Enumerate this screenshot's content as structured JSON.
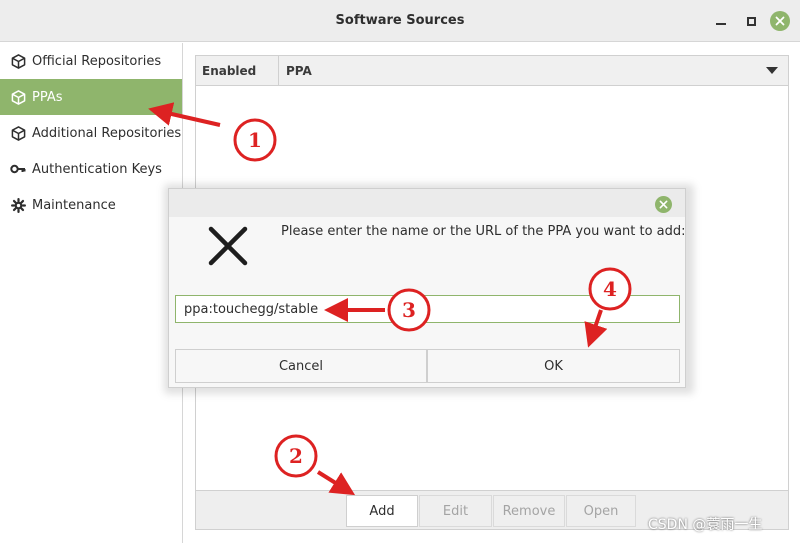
{
  "window": {
    "title": "Software Sources"
  },
  "sidebar": {
    "items": [
      {
        "label": "Official Repositories",
        "icon": "package-icon"
      },
      {
        "label": "PPAs",
        "icon": "package-icon",
        "active": true
      },
      {
        "label": "Additional Repositories",
        "icon": "package-icon"
      },
      {
        "label": "Authentication Keys",
        "icon": "key-icon"
      },
      {
        "label": "Maintenance",
        "icon": "gear-icon"
      }
    ]
  },
  "table": {
    "columns": [
      "Enabled",
      "PPA"
    ]
  },
  "toolbar": {
    "add_label": "Add",
    "edit_label": "Edit",
    "remove_label": "Remove",
    "open_label": "Open"
  },
  "dialog": {
    "message": "Please enter the name or the URL of the PPA you want to add:",
    "input_value": "ppa:touchegg/stable",
    "cancel_label": "Cancel",
    "ok_label": "OK"
  },
  "annotations": [
    "1",
    "2",
    "3",
    "4"
  ],
  "watermark": "CSDN @蓑雨一生",
  "colors": {
    "accent": "#8fb56c",
    "annotation": "#dd2222"
  }
}
